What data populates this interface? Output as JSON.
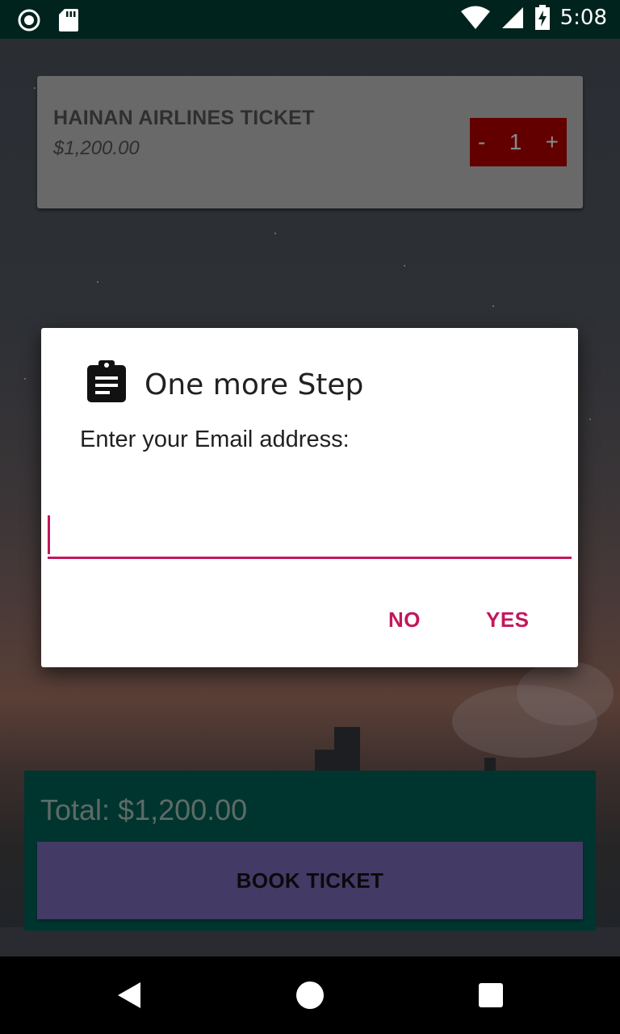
{
  "status_bar": {
    "time": "5:08",
    "icons": [
      "record-icon",
      "sd-card-icon",
      "wifi-icon",
      "signal-icon",
      "battery-charging-icon"
    ]
  },
  "ticket": {
    "title": "HAINAN AIRLINES TICKET",
    "price": "$1,200.00",
    "stepper": {
      "minus": "-",
      "quantity": "1",
      "plus": "+"
    }
  },
  "footer": {
    "total": "Total: $1,200.00",
    "book_button": "BOOK TICKET"
  },
  "dialog": {
    "icon": "clipboard-icon",
    "title": "One more Step",
    "message": "Enter your Email address:",
    "email_value": "",
    "no_label": "NO",
    "yes_label": "YES"
  },
  "colors": {
    "accent": "#c2185b",
    "status_bar": "#00231d",
    "footer_panel": "#00352f",
    "book_button": "#433a66",
    "stepper": "#620000"
  },
  "nav_bar": {
    "icons": [
      "back-icon",
      "home-icon",
      "recents-icon"
    ]
  }
}
